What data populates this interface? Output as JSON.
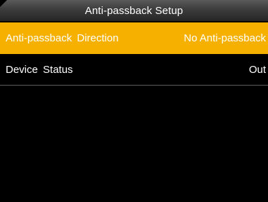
{
  "header": {
    "title": "Anti-passback Setup"
  },
  "menu": {
    "items": [
      {
        "label": "Anti-passback Direction",
        "value": "No Anti-passback",
        "selected": true
      },
      {
        "label": "Device Status",
        "value": "Out",
        "selected": false
      }
    ]
  },
  "colors": {
    "selected_row": "#f6b100",
    "background": "#000000",
    "divider": "#5e5e5e"
  }
}
